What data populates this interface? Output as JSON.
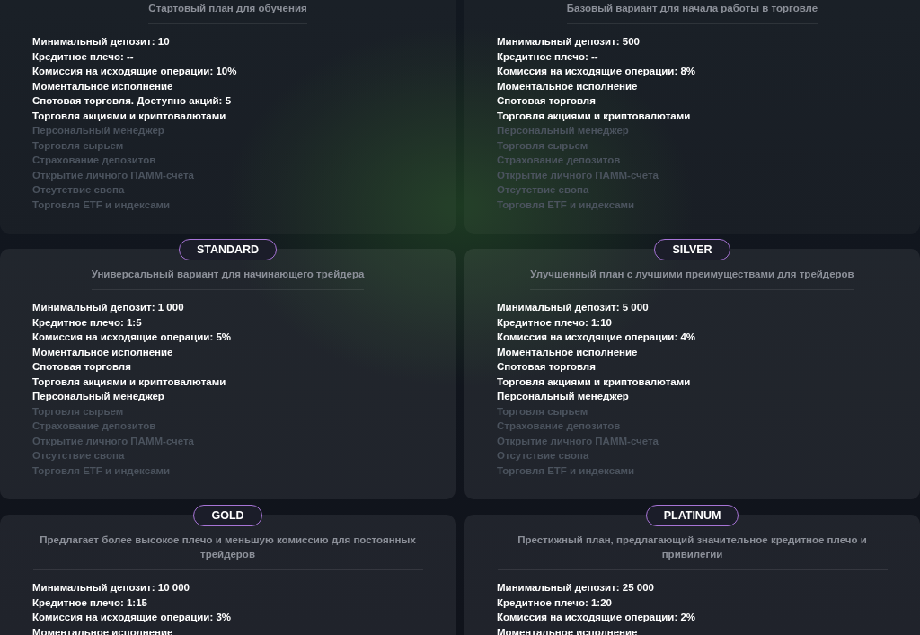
{
  "plans": [
    {
      "description": "Стартовый план для обучения",
      "features": [
        {
          "text": "Минимальный депозит: 10",
          "included": true
        },
        {
          "text": "Кредитное плечо: --",
          "included": true
        },
        {
          "text": "Комиссия на исходящие операции: 10%",
          "included": true
        },
        {
          "text": "Моментальное исполнение",
          "included": true
        },
        {
          "text": "Спотовая торговля. Доступно акций: 5",
          "included": true
        },
        {
          "text": "Торговля акциями и криптовалютами",
          "included": true
        },
        {
          "text": "Персональный менеджер",
          "included": false
        },
        {
          "text": "Торговля сырьем",
          "included": false
        },
        {
          "text": "Страхование депозитов",
          "included": false
        },
        {
          "text": "Открытие личного ПАММ-счета",
          "included": false
        },
        {
          "text": "Отсутствие свопа",
          "included": false
        },
        {
          "text": "Торговля ETF и индексами",
          "included": false
        }
      ]
    },
    {
      "description": "Базовый вариант для начала работы в торговле",
      "features": [
        {
          "text": "Минимальный депозит: 500",
          "included": true
        },
        {
          "text": "Кредитное плечо: --",
          "included": true
        },
        {
          "text": "Комиссия на исходящие операции: 8%",
          "included": true
        },
        {
          "text": "Моментальное исполнение",
          "included": true
        },
        {
          "text": "Спотовая торговля",
          "included": true
        },
        {
          "text": "Торговля акциями и криптовалютами",
          "included": true
        },
        {
          "text": "Персональный менеджер",
          "included": false
        },
        {
          "text": "Торговля сырьем",
          "included": false
        },
        {
          "text": "Страхование депозитов",
          "included": false
        },
        {
          "text": "Открытие личного ПАММ-счета",
          "included": false
        },
        {
          "text": "Отсутствие свопа",
          "included": false
        },
        {
          "text": "Торговля ETF и индексами",
          "included": false
        }
      ]
    },
    {
      "name": "STANDARD",
      "description": "Универсальный вариант для начинающего трейдера",
      "features": [
        {
          "text": "Минимальный депозит: 1 000",
          "included": true
        },
        {
          "text": "Кредитное плечо: 1:5",
          "included": true
        },
        {
          "text": "Комиссия на исходящие операции: 5%",
          "included": true
        },
        {
          "text": "Моментальное исполнение",
          "included": true
        },
        {
          "text": "Спотовая торговля",
          "included": true
        },
        {
          "text": "Торговля акциями и криптовалютами",
          "included": true
        },
        {
          "text": "Персональный менеджер",
          "included": true
        },
        {
          "text": "Торговля сырьем",
          "included": false
        },
        {
          "text": "Страхование депозитов",
          "included": false
        },
        {
          "text": "Открытие личного ПАММ-счета",
          "included": false
        },
        {
          "text": "Отсутствие свопа",
          "included": false
        },
        {
          "text": "Торговля ETF и индексами",
          "included": false
        }
      ]
    },
    {
      "name": "SILVER",
      "description": "Улучшенный план с лучшими преимуществами для трейдеров",
      "features": [
        {
          "text": "Минимальный депозит: 5 000",
          "included": true
        },
        {
          "text": "Кредитное плечо: 1:10",
          "included": true
        },
        {
          "text": "Комиссия на исходящие операции: 4%",
          "included": true
        },
        {
          "text": "Моментальное исполнение",
          "included": true
        },
        {
          "text": "Спотовая торговля",
          "included": true
        },
        {
          "text": "Торговля акциями и криптовалютами",
          "included": true
        },
        {
          "text": "Персональный менеджер",
          "included": true
        },
        {
          "text": "Торговля сырьем",
          "included": false
        },
        {
          "text": "Страхование депозитов",
          "included": false
        },
        {
          "text": "Открытие личного ПАММ-счета",
          "included": false
        },
        {
          "text": "Отсутствие свопа",
          "included": false
        },
        {
          "text": "Торговля ETF и индексами",
          "included": false
        }
      ]
    },
    {
      "name": "GOLD",
      "description": "Предлагает более высокое плечо и меньшую комиссию для постоянных трейдеров",
      "features": [
        {
          "text": "Минимальный депозит: 10 000",
          "included": true
        },
        {
          "text": "Кредитное плечо: 1:15",
          "included": true
        },
        {
          "text": "Комиссия на исходящие операции: 3%",
          "included": true
        },
        {
          "text": "Моментальное исполнение",
          "included": true
        }
      ]
    },
    {
      "name": "PLATINUM",
      "description": "Престижный план, предлагающий значительное кредитное плечо и привилегии",
      "features": [
        {
          "text": "Минимальный депозит: 25 000",
          "included": true
        },
        {
          "text": "Кредитное плечо: 1:20",
          "included": true
        },
        {
          "text": "Комиссия на исходящие операции: 2%",
          "included": true
        },
        {
          "text": "Моментальное исполнение",
          "included": true
        }
      ]
    }
  ]
}
